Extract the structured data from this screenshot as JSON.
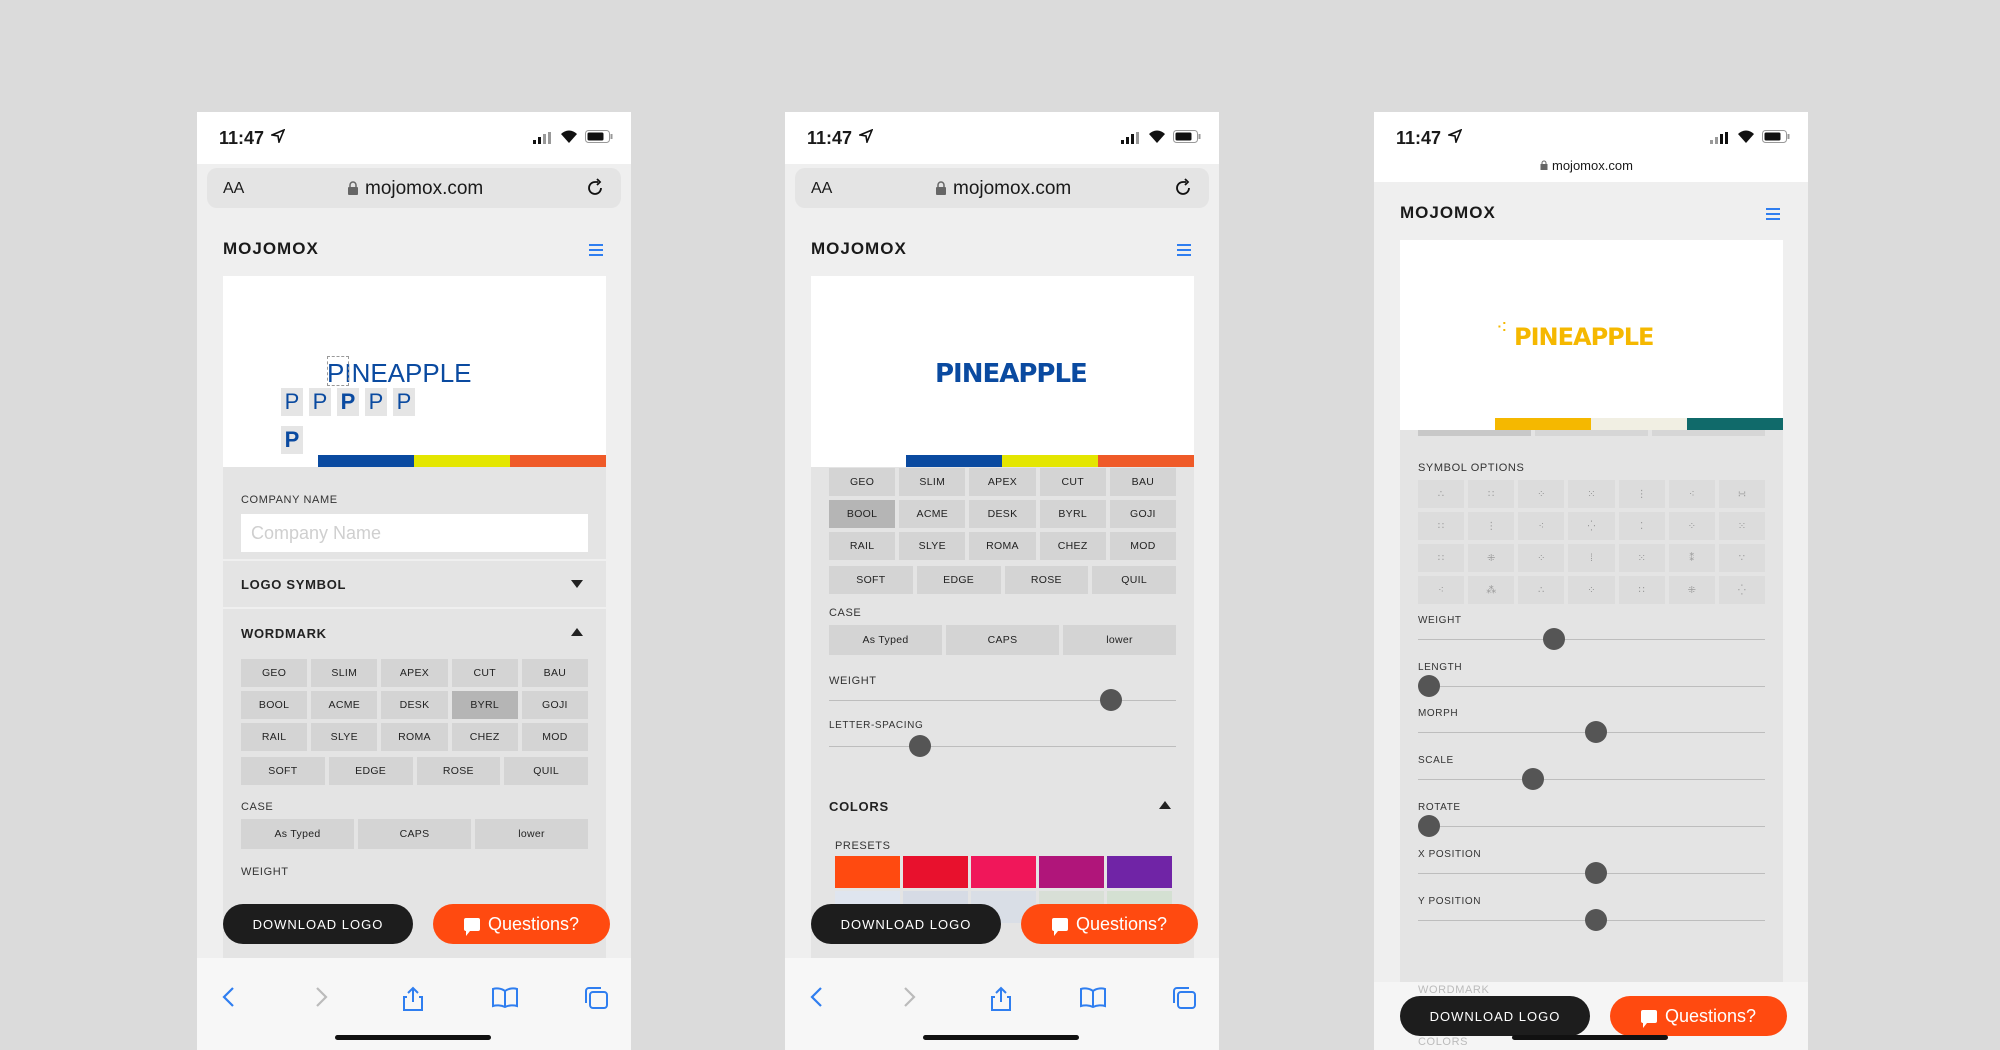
{
  "status": {
    "time": "11:47"
  },
  "browser": {
    "aa": "AA",
    "url": "mojomox.com",
    "url_small": "mojomox.com"
  },
  "site": {
    "brand": "MOJOMOX"
  },
  "logo": {
    "word": "PINEAPPLE",
    "letter": "P"
  },
  "colors": {
    "blue": "#0a4aa0",
    "yellow": "#e4e600",
    "orange": "#ef5a28",
    "gold": "#f5b800",
    "cream": "#f1efe3",
    "teal": "#106a6a",
    "accent": "#ff4a10"
  },
  "form": {
    "company_label": "COMPANY NAME",
    "company_placeholder": "Company Name"
  },
  "sections": {
    "logo_symbol": "LOGO SYMBOL",
    "wordmark": "WORDMARK",
    "colors": "COLORS",
    "symbol_options": "SYMBOL OPTIONS"
  },
  "fonts": [
    [
      "GEO",
      "SLIM",
      "APEX",
      "CUT",
      "BAU"
    ],
    [
      "BOOL",
      "ACME",
      "DESK",
      "BYRL",
      "GOJI"
    ],
    [
      "RAIL",
      "SLYE",
      "ROMA",
      "CHEZ",
      "MOD"
    ],
    [
      "SOFT",
      "EDGE",
      "ROSE",
      "QUIL"
    ]
  ],
  "selected_font_phone1": "BYRL",
  "selected_font_phone2": "BOOL",
  "case": {
    "label": "CASE",
    "options": [
      "As Typed",
      "CAPS",
      "lower"
    ]
  },
  "sliders": {
    "weight": "WEIGHT",
    "letter_spacing": "LETTER-SPACING",
    "length": "LENGTH",
    "morph": "MORPH",
    "scale": "SCALE",
    "rotate": "ROTATE",
    "x_position": "X POSITION",
    "y_position": "Y POSITION",
    "weight_partial": "WEIGHT"
  },
  "slider_values": {
    "p2_weight": 0.78,
    "p2_letter_spacing": 0.23,
    "p3_weight": 0.36,
    "p3_length": 0.0,
    "p3_morph": 0.48,
    "p3_scale": 0.3,
    "p3_rotate": 0.0,
    "p3_x": 0.48,
    "p3_y": 0.48
  },
  "presets": {
    "label": "PRESETS",
    "swatches": [
      "#ff4a10",
      "#e8112d",
      "#f0175a",
      "#b0157a",
      "#7024a6"
    ]
  },
  "actions": {
    "download": "DOWNLOAD LOGO",
    "questions": "Questions?"
  },
  "partial_sections": {
    "wordmark": "WORDMARK",
    "colors": "COLORS"
  }
}
